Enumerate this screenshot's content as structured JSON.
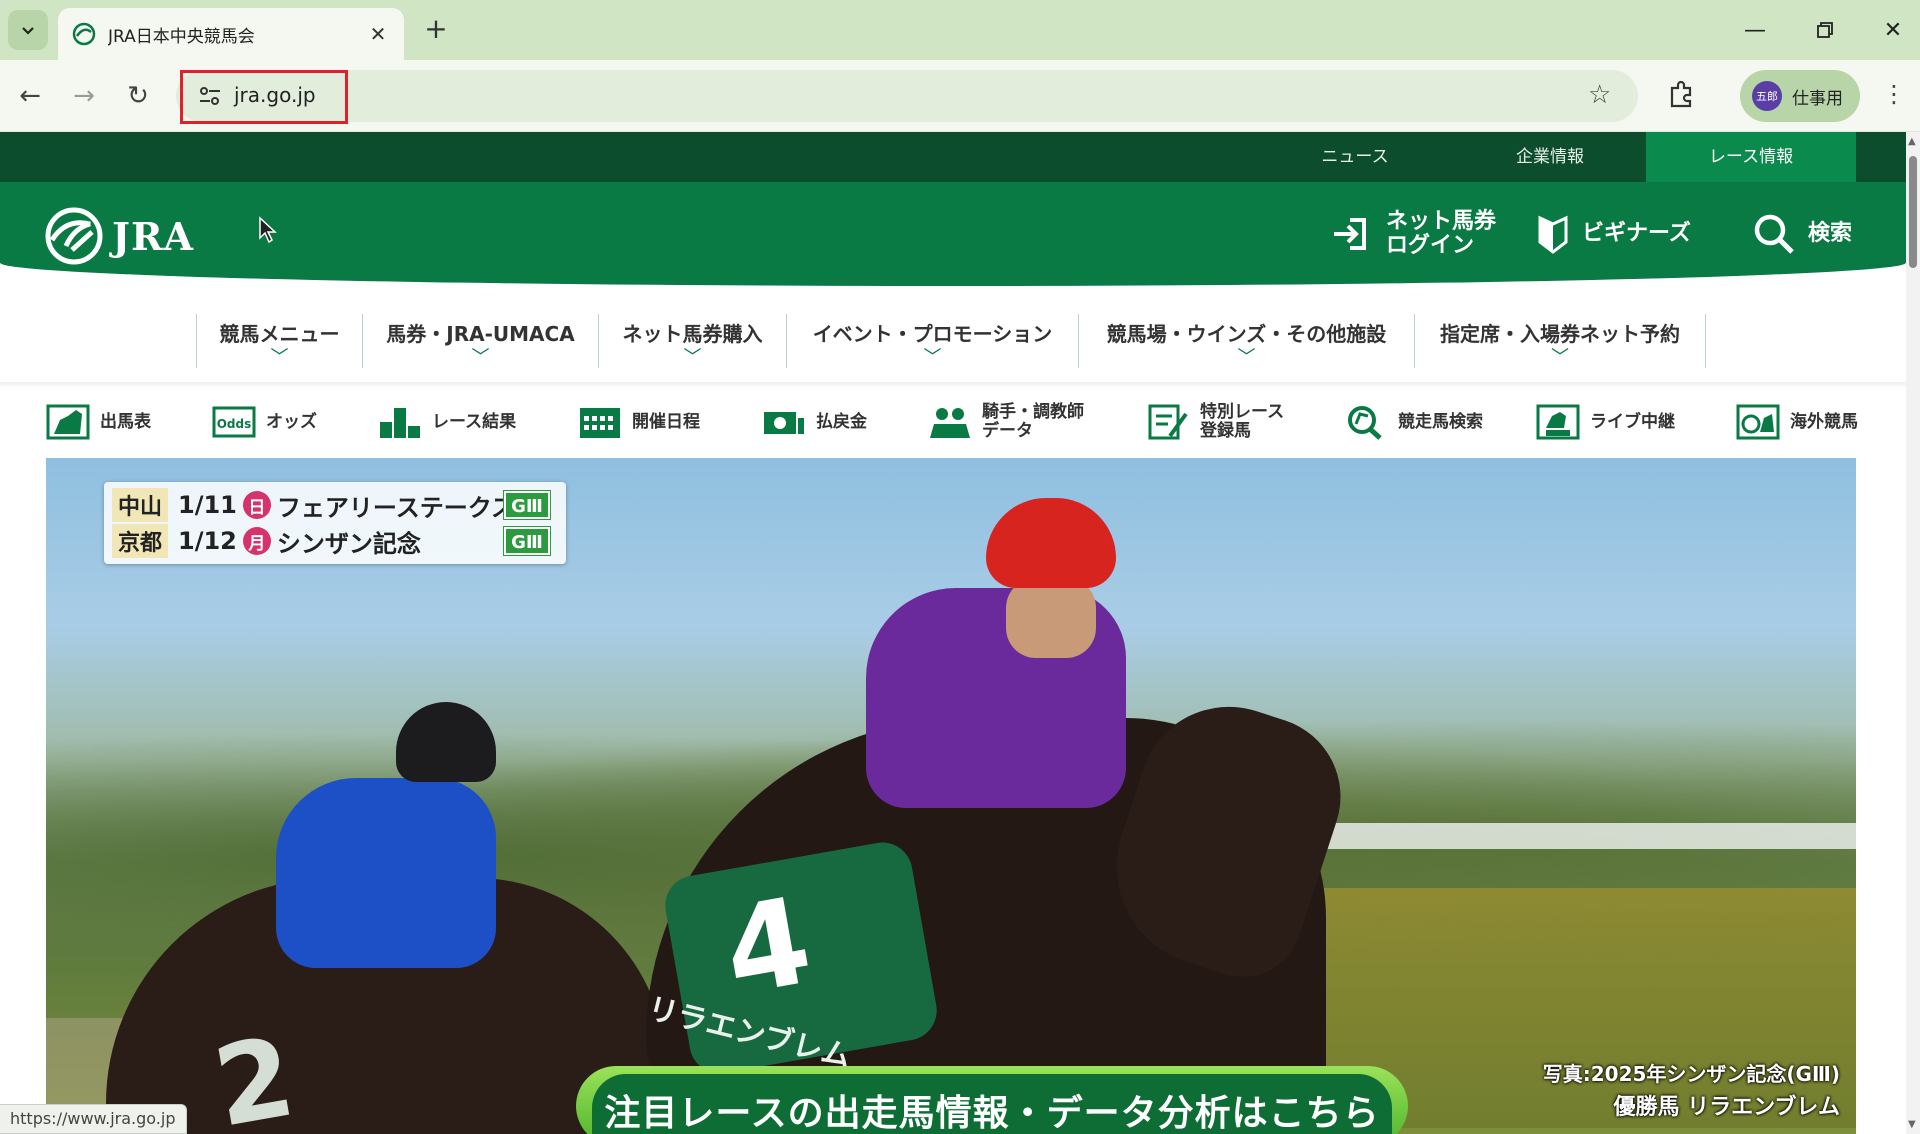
{
  "browser": {
    "tab_title": "JRA日本中央競馬会",
    "url": "jra.go.jp",
    "profile_avatar": "五郎",
    "profile_label": "仕事用",
    "status_url": "https://www.jra.go.jp"
  },
  "site": {
    "top_links": [
      "ニュース",
      "企業情報",
      "レース情報"
    ],
    "logo_text": "JRA",
    "header_buttons": {
      "login_line1": "ネット馬券",
      "login_line2": "ログイン",
      "beginners": "ビギナーズ",
      "search": "検索"
    },
    "mega_menu": [
      "競馬メニュー",
      "馬券・JRA-UMACA",
      "ネット馬券購入",
      "イベント・プロモーション",
      "競馬場・ウインズ・その他施設",
      "指定席・入場券ネット予約"
    ],
    "quick_nav": {
      "entries": "出馬表",
      "odds": "オッズ",
      "odds_icon_text": "Odds",
      "results": "レース結果",
      "schedule": "開催日程",
      "payout": "払戻金",
      "jockey_line1": "騎手・調教師",
      "jockey_line2": "データ",
      "special_line1": "特別レース",
      "special_line2": "登録馬",
      "horse_search": "競走馬検索",
      "live": "ライブ中継",
      "overseas": "海外競馬"
    },
    "hero": {
      "races": [
        {
          "venue": "中山",
          "date": "1/11",
          "dow": "日",
          "name": "フェアリーステークス",
          "grade": "GⅢ"
        },
        {
          "venue": "京都",
          "date": "1/12",
          "dow": "月",
          "name": "シンザン記念",
          "grade": "GⅢ"
        }
      ],
      "saddle_number": "4",
      "saddle_name": "リラエンブレム",
      "second_number": "2",
      "caption_line1": "写真:2025年シンザン記念(GⅢ)",
      "caption_line2": "優勝馬 リラエンブレム",
      "cta": "注目レースの出走馬情報・データ分析はこちら"
    }
  },
  "colors": {
    "jra_green": "#0a7a44",
    "dark_green": "#0b4d2c",
    "tab_bar": "#cfe5c4",
    "highlight_red": "#e0212b"
  },
  "icons": [
    "chevron-down-icon",
    "close-icon",
    "plus-icon",
    "back-icon",
    "forward-icon",
    "reload-icon",
    "site-info-icon",
    "star-icon",
    "extensions-icon",
    "menu-icon",
    "login-icon",
    "beginners-icon",
    "search-icon"
  ]
}
